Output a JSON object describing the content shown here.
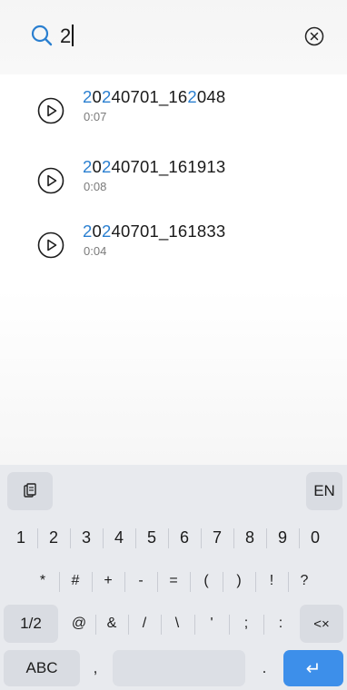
{
  "search": {
    "query": "2",
    "placeholder": ""
  },
  "results": [
    {
      "name_prefix": "",
      "name_highlight": "2",
      "name_suffix": "0",
      "name_highlight2": "2",
      "name_rest": "40701_16",
      "name_highlight3": "2",
      "name_tail": "048",
      "duration": "0:07",
      "full": "20240701_162048"
    },
    {
      "name_prefix": "",
      "name_highlight": "2",
      "name_suffix": "0",
      "name_highlight2": "2",
      "name_rest": "40701_161913",
      "name_highlight3": "",
      "name_tail": "",
      "duration": "0:08",
      "full": "20240701_161913"
    },
    {
      "name_prefix": "",
      "name_highlight": "2",
      "name_suffix": "0",
      "name_highlight2": "2",
      "name_rest": "40701_161833",
      "name_highlight3": "",
      "name_tail": "",
      "duration": "0:04",
      "full": "20240701_161833"
    }
  ],
  "keyboard": {
    "language": "EN",
    "digits": [
      "1",
      "2",
      "3",
      "4",
      "5",
      "6",
      "7",
      "8",
      "9",
      "0"
    ],
    "symbols_row1": [
      "*",
      "#",
      "+",
      "-",
      "=",
      "(",
      ")",
      "!",
      "?"
    ],
    "page_toggle": "1/2",
    "symbols_row2": [
      "@",
      "&",
      "/",
      "\\",
      "'",
      ";",
      ":"
    ],
    "backspace": "<×",
    "abc": "ABC",
    "comma": ",",
    "period": ".",
    "enter": "↵"
  },
  "colors": {
    "accent": "#2a7fd0",
    "enter_key": "#3d8fea",
    "keyboard_bg": "#e8eaee"
  },
  "icons": {
    "search": "search-icon",
    "clear": "clear-icon",
    "play": "play-icon",
    "clipboard": "clipboard-icon",
    "enter": "enter-icon",
    "backspace": "backspace-icon"
  }
}
